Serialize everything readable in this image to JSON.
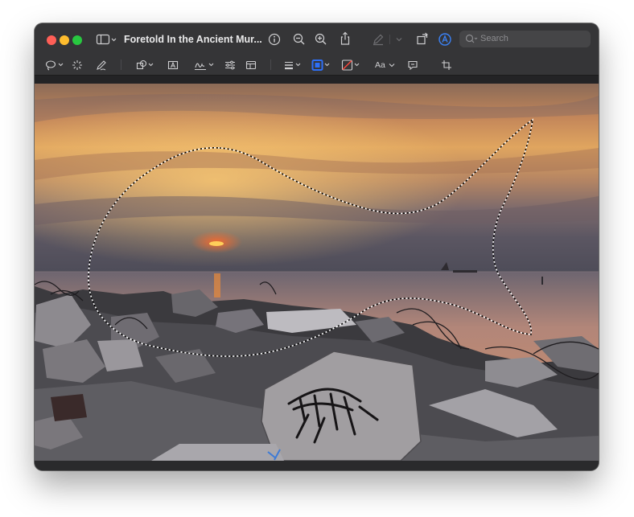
{
  "window": {
    "title": "Foretold In the Ancient Mur...",
    "search_placeholder": "Search"
  },
  "toolbar": {
    "text_style_label": "Aa"
  },
  "colors": {
    "accent": "#2d6ff7",
    "close": "#ff5f57",
    "minimize": "#febc2e",
    "zoom": "#28c840",
    "selection_box": "#2d6ff7"
  },
  "icons": [
    "sidebar-toggle-icon",
    "info-icon",
    "zoom-out-icon",
    "zoom-in-icon",
    "share-icon",
    "highlight-pen-icon",
    "rotate-icon",
    "markup-icon",
    "search-icon",
    "lasso-selection-icon",
    "smart-lasso-icon",
    "sketch-icon",
    "shapes-icon",
    "text-box-icon",
    "sign-icon",
    "adjust-color-icon",
    "page-layout-icon",
    "line-style-icon",
    "border-color-icon",
    "fill-color-icon",
    "text-style-icon",
    "note-icon",
    "crop-icon"
  ],
  "image": {
    "description_shown": "sunset over water with concrete rubble; dotted lasso selection"
  }
}
